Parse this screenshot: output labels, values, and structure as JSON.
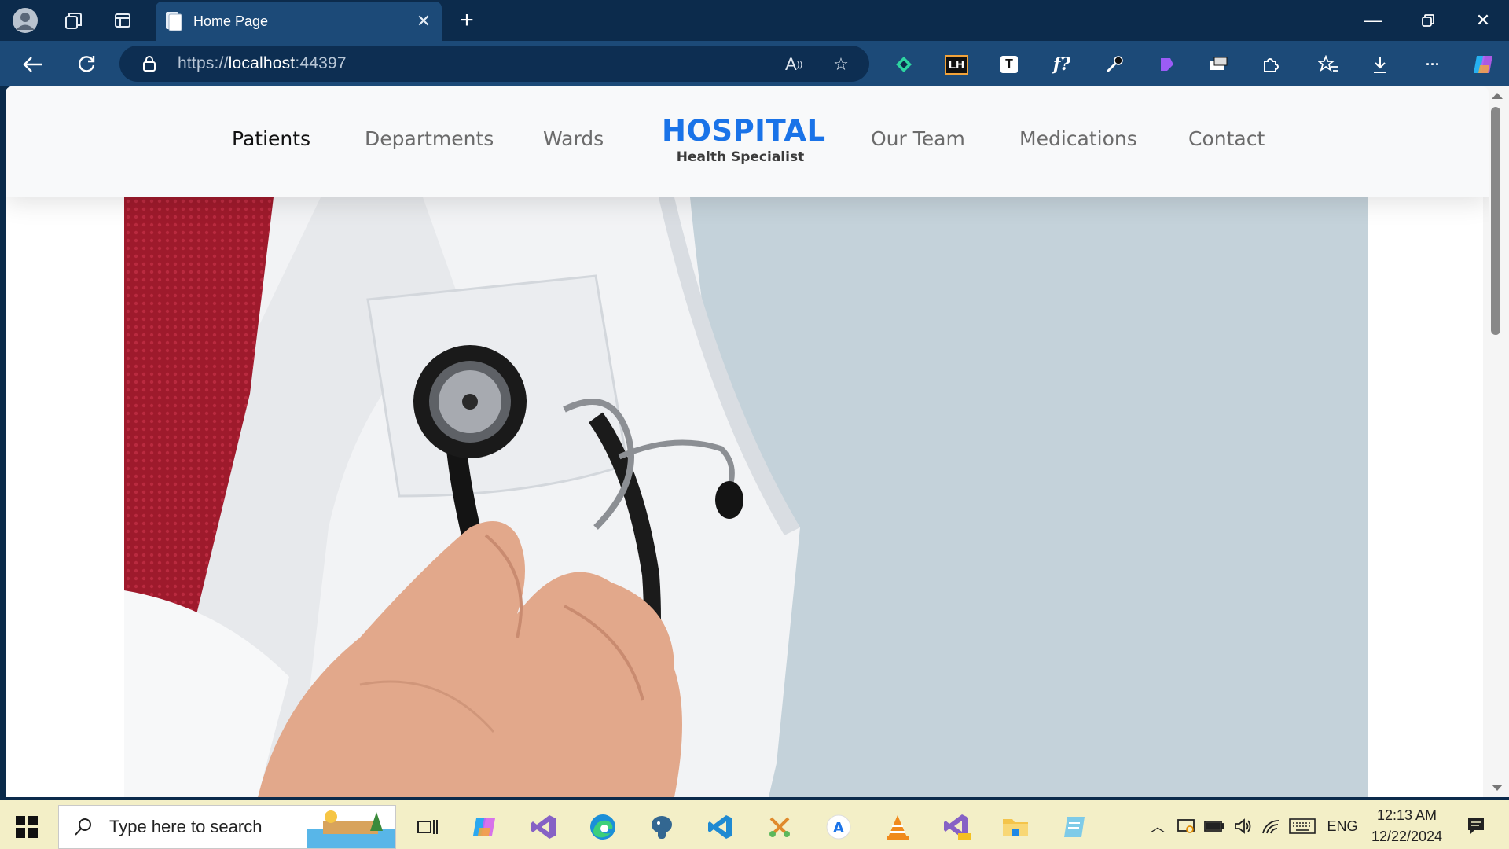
{
  "browser": {
    "tab_title": "Home Page",
    "url_scheme": "https://",
    "url_host": "localhost",
    "url_port": ":44397"
  },
  "site": {
    "menu": [
      "Patients",
      "Departments",
      "Wards",
      "Our Team",
      "Medications",
      "Contact"
    ],
    "active_menu": "Patients",
    "brand_title": "HOSPITAL",
    "brand_subtitle": "Health Specialist",
    "brand_color": "#1a73e8",
    "hero_background": "#c4d2da"
  },
  "taskbar": {
    "search_placeholder": "Type here to search",
    "language": "ENG",
    "time": "12:13 AM",
    "date": "12/22/2024"
  },
  "extensions": [
    "LH",
    "T",
    "f?"
  ]
}
